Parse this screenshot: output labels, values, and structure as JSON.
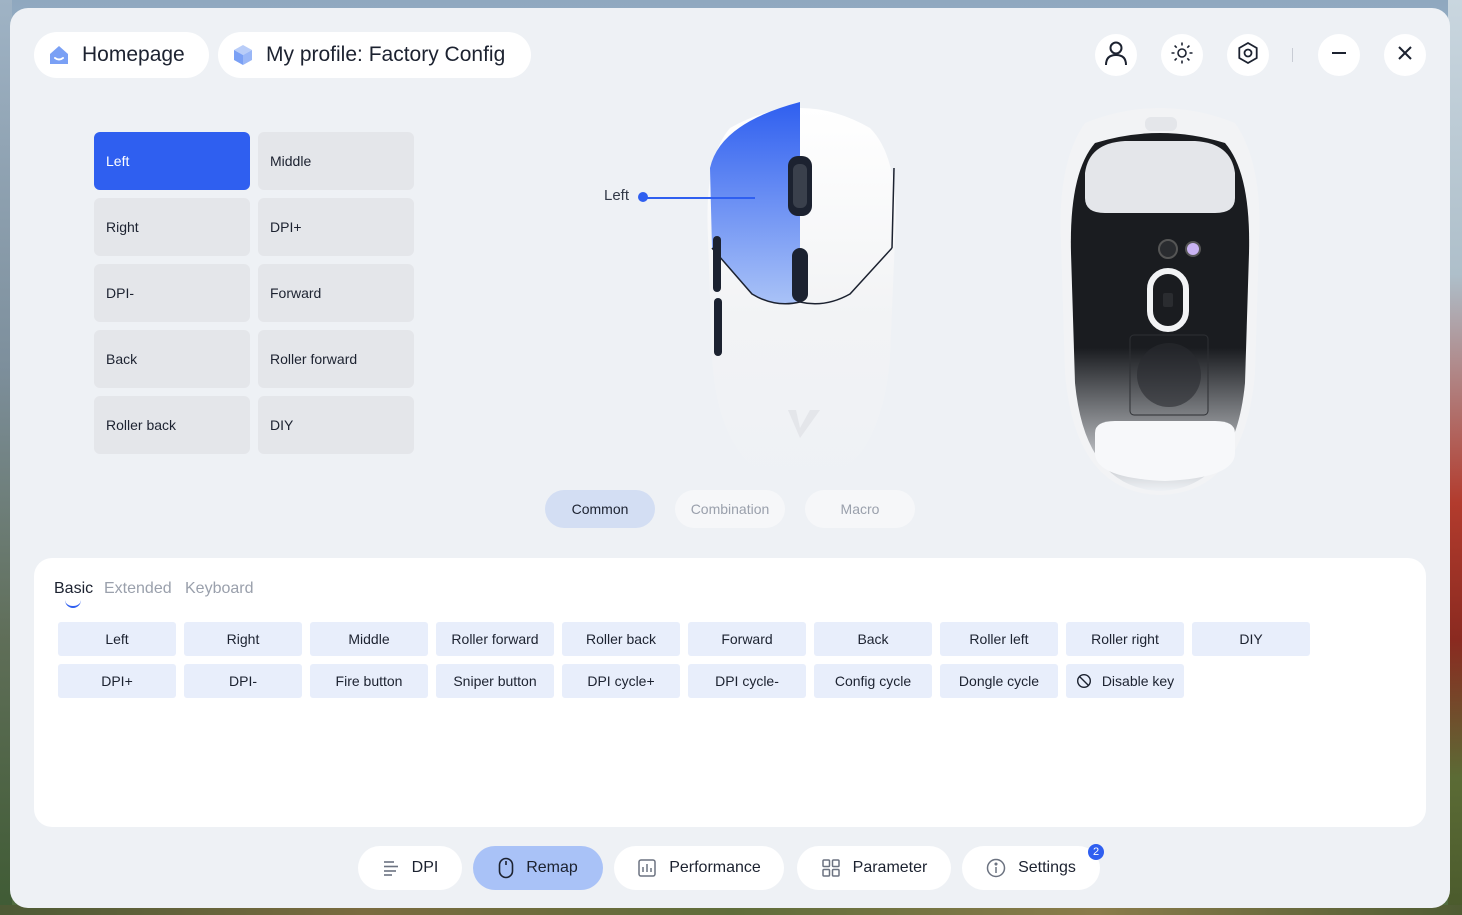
{
  "header": {
    "home_label": "Homepage",
    "profile_label": "My profile: Factory Config"
  },
  "icons": {
    "home": "home-icon",
    "profile": "cube-icon",
    "user": "user-icon",
    "brightness": "sun-icon",
    "settings": "hexagon-gear-icon",
    "minimize": "minimize-icon",
    "close": "close-icon"
  },
  "button_grid": [
    {
      "label": "Left",
      "active": true
    },
    {
      "label": "Middle",
      "active": false
    },
    {
      "label": "Right",
      "active": false
    },
    {
      "label": "DPI+",
      "active": false
    },
    {
      "label": "DPI-",
      "active": false
    },
    {
      "label": "Forward",
      "active": false
    },
    {
      "label": "Back",
      "active": false
    },
    {
      "label": "Roller forward",
      "active": false
    },
    {
      "label": "Roller back",
      "active": false
    },
    {
      "label": "DIY",
      "active": false
    }
  ],
  "mouse_preview": {
    "selected_label": "Left"
  },
  "mode_tabs": {
    "common": "Common",
    "combination": "Combination",
    "macro": "Macro",
    "active": "Common"
  },
  "panel": {
    "tabs": {
      "basic": "Basic",
      "extended": "Extended",
      "keyboard": "Keyboard"
    },
    "active_tab": "Basic",
    "keys_row1": [
      "Left",
      "Right",
      "Middle",
      "Roller forward",
      "Roller back",
      "Forward",
      "Back",
      "Roller left",
      "Roller right",
      "DIY"
    ],
    "keys_row2": [
      "DPI+",
      "DPI-",
      "Fire button",
      "Sniper button",
      "DPI cycle+",
      "DPI cycle-",
      "Config cycle",
      "Dongle cycle",
      "Disable key"
    ]
  },
  "bottom_nav": {
    "dpi": "DPI",
    "remap": "Remap",
    "performance": "Performance",
    "parameter": "Parameter",
    "settings": "Settings",
    "settings_badge": "2",
    "active": "Remap"
  },
  "colors": {
    "accent": "#2f5ff0",
    "active_nav": "#a9c2f7",
    "key_bg": "#e8eefb"
  }
}
